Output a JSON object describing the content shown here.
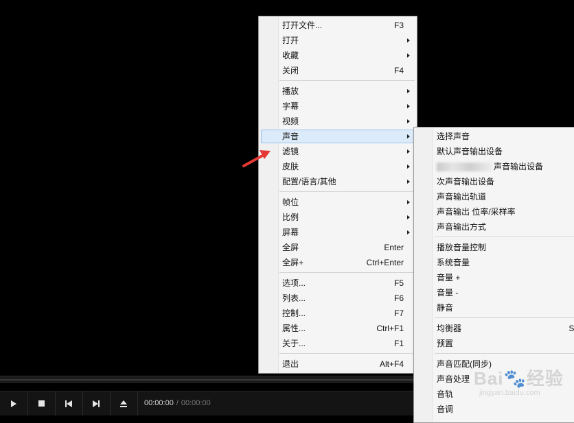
{
  "main_menu": {
    "groups": [
      [
        {
          "label": "打开文件...",
          "shortcut": "F3"
        },
        {
          "label": "打开",
          "submenu": true
        },
        {
          "label": "收藏",
          "submenu": true
        },
        {
          "label": "关闭",
          "shortcut": "F4"
        }
      ],
      [
        {
          "label": "播放",
          "submenu": true
        },
        {
          "label": "字幕",
          "submenu": true
        },
        {
          "label": "视频",
          "submenu": true
        },
        {
          "label": "声音",
          "submenu": true,
          "highlighted": true
        },
        {
          "label": "滤镜",
          "submenu": true
        },
        {
          "label": "皮肤",
          "submenu": true
        },
        {
          "label": "配置/语言/其他",
          "submenu": true
        }
      ],
      [
        {
          "label": "帧位",
          "submenu": true
        },
        {
          "label": "比例",
          "submenu": true
        },
        {
          "label": "屏幕",
          "submenu": true
        },
        {
          "label": "全屏",
          "shortcut": "Enter"
        },
        {
          "label": "全屏+",
          "shortcut": "Ctrl+Enter"
        }
      ],
      [
        {
          "label": "选项...",
          "shortcut": "F5"
        },
        {
          "label": "列表...",
          "shortcut": "F6"
        },
        {
          "label": "控制...",
          "shortcut": "F7"
        },
        {
          "label": "属性...",
          "shortcut": "Ctrl+F1"
        },
        {
          "label": "关于...",
          "shortcut": "F1"
        }
      ],
      [
        {
          "label": "退出",
          "shortcut": "Alt+F4"
        }
      ]
    ]
  },
  "sound_submenu": {
    "groups": [
      [
        {
          "label": "选择声音"
        },
        {
          "label": "默认声音输出设备"
        },
        {
          "label": "声音输出设备",
          "blurred_prefix": true
        },
        {
          "label": "次声音输出设备"
        },
        {
          "label": "声音输出轨道"
        },
        {
          "label": "声音输出 位率/采样率"
        },
        {
          "label": "声音输出方式"
        }
      ],
      [
        {
          "label": "播放音量控制"
        },
        {
          "label": "系统音量"
        },
        {
          "label": "音量 +"
        },
        {
          "label": "音量 -"
        },
        {
          "label": "静音"
        }
      ],
      [
        {
          "label": "均衡器",
          "shortcut": "Sh"
        },
        {
          "label": "预置"
        }
      ],
      [
        {
          "label": "声音匹配(同步)"
        },
        {
          "label": "声音处理"
        },
        {
          "label": "音轨"
        },
        {
          "label": "音调"
        }
      ]
    ]
  },
  "player": {
    "time_current": "00:00:00",
    "time_separator": "/",
    "time_total": "00:00:00",
    "buttons": [
      "play-icon",
      "stop-icon",
      "previous-icon",
      "next-icon",
      "eject-icon"
    ]
  },
  "annotation": {
    "color": "#e53935"
  },
  "watermark": {
    "main": "Bai🐾经验",
    "sub": "jingyan.baidu.com"
  }
}
